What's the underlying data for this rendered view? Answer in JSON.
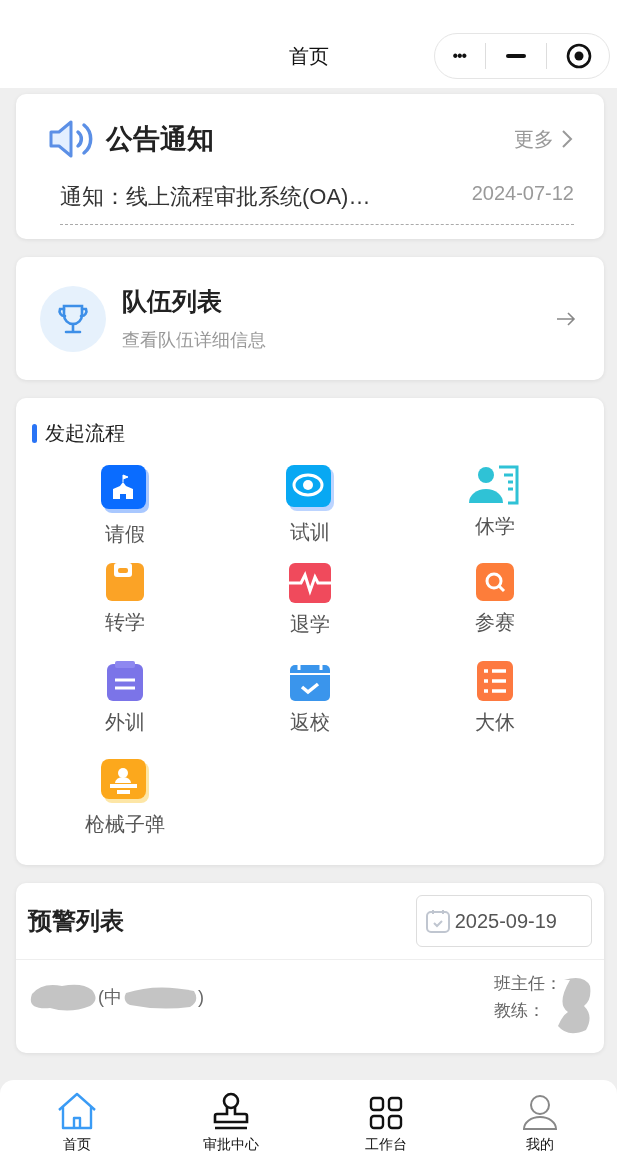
{
  "nav_bar": {
    "title": "首页",
    "capsule": {
      "more": "•••"
    }
  },
  "notice": {
    "title": "公告通知",
    "more": "更多",
    "items": [
      {
        "text": "通知：线上流程审批系统(OA)…",
        "date": "2024-07-12"
      }
    ]
  },
  "team": {
    "title": "队伍列表",
    "subtitle": "查看队伍详细信息"
  },
  "process": {
    "title": "发起流程",
    "items": [
      {
        "label": "请假",
        "kind": "school"
      },
      {
        "label": "试训",
        "kind": "eye"
      },
      {
        "label": "休学",
        "kind": "person"
      },
      {
        "label": "转学",
        "kind": "folder"
      },
      {
        "label": "退学",
        "kind": "pulse"
      },
      {
        "label": "参赛",
        "kind": "search"
      },
      {
        "label": "外训",
        "kind": "clipboard"
      },
      {
        "label": "返校",
        "kind": "calendar"
      },
      {
        "label": "大休",
        "kind": "list"
      },
      {
        "label": "枪械子弹",
        "kind": "lecturer"
      }
    ]
  },
  "warning": {
    "title": "预警列表",
    "date": "2025-09-19",
    "row": {
      "class_fragment": "(中",
      "class_end": ")",
      "head_teacher_label": "班主任：",
      "coach_label": "教练："
    }
  },
  "tab_bar": [
    {
      "label": "首页",
      "kind": "home",
      "selected": true
    },
    {
      "label": "审批中心",
      "kind": "stamp",
      "selected": false
    },
    {
      "label": "工作台",
      "kind": "grid",
      "selected": false
    },
    {
      "label": "我的",
      "kind": "user",
      "selected": false
    }
  ]
}
